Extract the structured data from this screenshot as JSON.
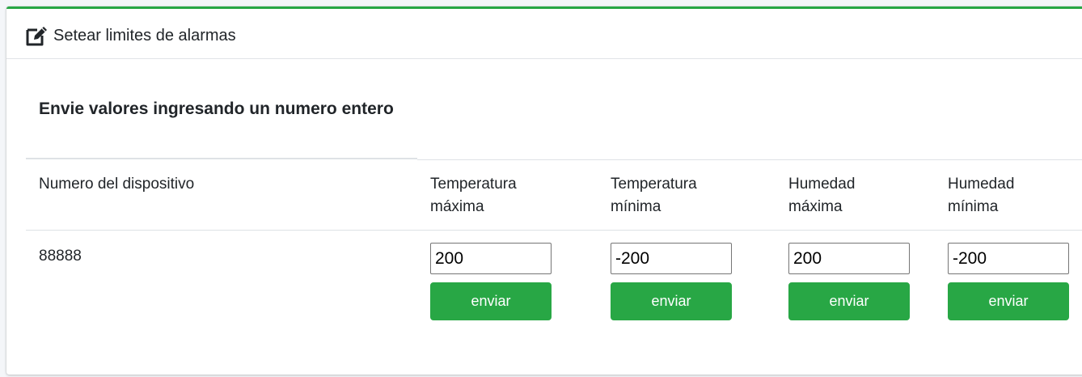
{
  "card": {
    "header_icon": "edit-icon",
    "title": "Setear limites de alarmas"
  },
  "form": {
    "heading": "Envie valores ingresando un numero entero",
    "columns": {
      "device": "Numero del dispositivo",
      "temp_max": "Temperatura máxima",
      "temp_min": "Temperatura mínima",
      "hum_max": "Humedad máxima",
      "hum_min": "Humedad mínima"
    },
    "row": {
      "device_number": "88888",
      "temp_max_value": "200",
      "temp_min_value": "-200",
      "hum_max_value": "200",
      "hum_min_value": "-200"
    },
    "send_label": "enviar"
  },
  "colors": {
    "accent": "#28a745",
    "text": "#212529",
    "border": "#dee2e6"
  }
}
